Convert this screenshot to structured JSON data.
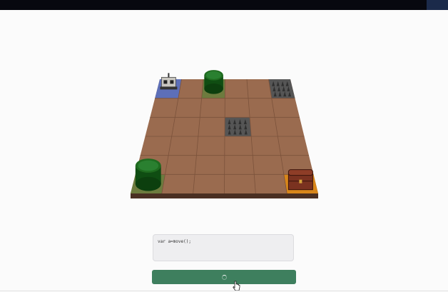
{
  "window": {
    "topbar_color": "#07080f"
  },
  "board": {
    "rows": 6,
    "cols": 6,
    "tile_color": "#9a6b4f",
    "grid_line_color": "#7b523b",
    "edge_color": "#4a2f22",
    "cells": [
      {
        "row": 0,
        "col": 0,
        "type": "start-pad",
        "color": "#5d6fb8"
      },
      {
        "row": 0,
        "col": 2,
        "type": "grass",
        "color": "#6d7b3e"
      },
      {
        "row": 0,
        "col": 5,
        "type": "spikes",
        "color": "#555555"
      },
      {
        "row": 2,
        "col": 3,
        "type": "spikes",
        "color": "#555555"
      },
      {
        "row": 5,
        "col": 0,
        "type": "grass",
        "color": "#6d7b3e"
      },
      {
        "row": 5,
        "col": 5,
        "type": "goal-pad",
        "color": "#d8861a"
      }
    ],
    "objects": [
      {
        "kind": "robot",
        "icon": "robot-icon",
        "row": 0,
        "col": 0
      },
      {
        "kind": "bush",
        "icon": "bush-icon",
        "row": 0,
        "col": 2,
        "color": "#1f6b1f"
      },
      {
        "kind": "bush",
        "icon": "bush-icon",
        "row": 5,
        "col": 0,
        "color": "#1f6b1f"
      },
      {
        "kind": "chest",
        "icon": "treasure-chest-icon",
        "row": 5,
        "col": 5,
        "color": "#7a3220"
      }
    ]
  },
  "editor": {
    "code": "var a=move();"
  },
  "run_button": {
    "state": "loading",
    "icon": "spinner-icon",
    "color": "#3e7f5e"
  }
}
